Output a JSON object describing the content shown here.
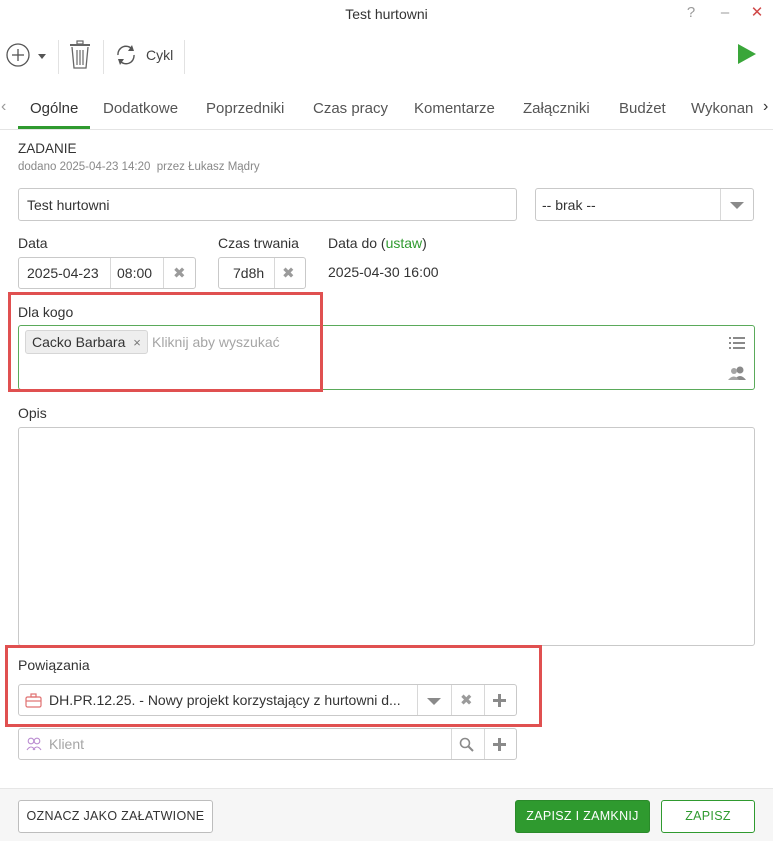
{
  "window": {
    "title": "Test hurtowni",
    "help": "?",
    "minimize": "–",
    "close": "✕"
  },
  "toolbar": {
    "cycle_label": "Cykl"
  },
  "tabs": [
    {
      "label": "Ogólne",
      "active": true
    },
    {
      "label": "Dodatkowe"
    },
    {
      "label": "Poprzedniki"
    },
    {
      "label": "Czas pracy"
    },
    {
      "label": "Komentarze"
    },
    {
      "label": "Załączniki"
    },
    {
      "label": "Budżet"
    },
    {
      "label": "Wykonan"
    }
  ],
  "task": {
    "header": "ZADANIE",
    "meta": "dodano 2025-04-23 14:20  przez Łukasz Mądry",
    "title_value": "Test hurtowni",
    "status_select": "-- brak --",
    "date_label": "Data",
    "date_value": "2025-04-23",
    "time_value": "08:00",
    "duration_label": "Czas trwania",
    "duration_value": "7d8h",
    "date_to_label": "Data do (",
    "date_to_link": "ustaw",
    "date_to_close": ")",
    "date_to_value": "2025-04-30 16:00"
  },
  "assignee": {
    "label": "Dla kogo",
    "chips": [
      "Cacko Barbara"
    ],
    "chip_remove": "×",
    "placeholder": "Kliknij aby wyszukać"
  },
  "description": {
    "label": "Opis",
    "value": ""
  },
  "relations": {
    "label": "Powiązania",
    "project_value": "DH.PR.12.25. - Nowy projekt korzystający z hurtowni d...",
    "client_placeholder": "Klient"
  },
  "footer": {
    "mark_done": "OZNACZ JAKO ZAŁATWIONE",
    "save_close": "ZAPISZ I ZAMKNIJ",
    "save": "ZAPISZ"
  },
  "colors": {
    "accent": "#2f9a2f",
    "highlight": "#e05050"
  }
}
